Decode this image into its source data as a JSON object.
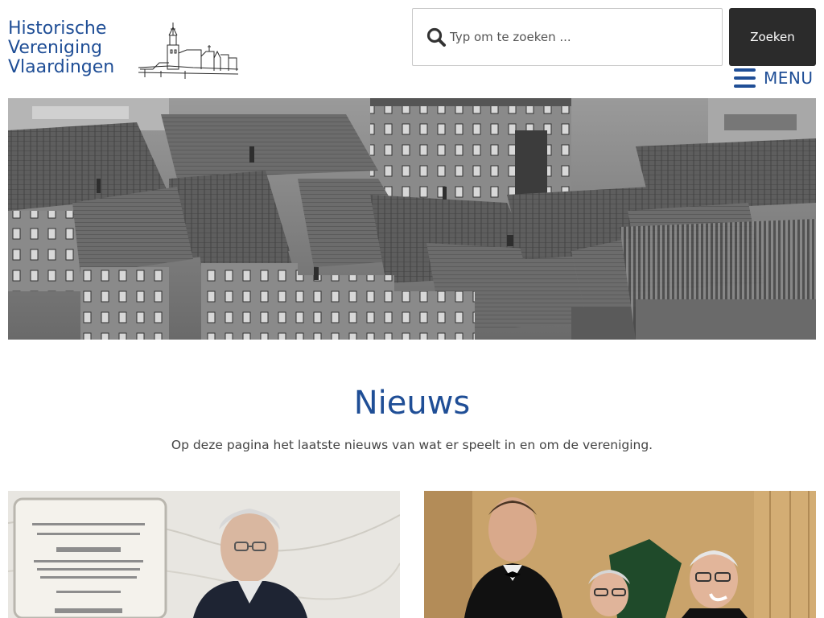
{
  "logo": {
    "line1": "Historische",
    "line2": "Vereniging",
    "line3": "Vlaardingen"
  },
  "search": {
    "placeholder": "Typ om te zoeken ...",
    "value": "",
    "button_label": "Zoeken",
    "icon": "search-icon"
  },
  "menu": {
    "label": "MENU",
    "icon": "hamburger-icon"
  },
  "page": {
    "title": "Nieuws",
    "subtitle": "Op deze pagina het laatste nieuws van wat er speelt in en om de vereniging."
  },
  "colors": {
    "brand": "#1f4e96",
    "button_bg": "#2b2b2b",
    "text": "#444444"
  }
}
